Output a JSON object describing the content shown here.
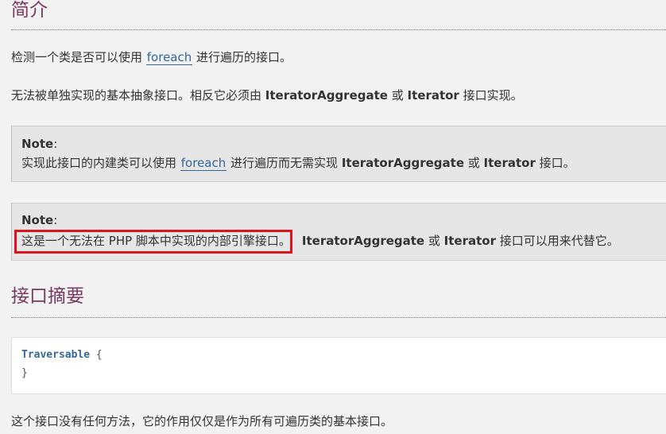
{
  "intro": {
    "title": "简介",
    "p1_before": "检测一个类是否可以使用 ",
    "p1_link": "foreach",
    "p1_after": " 进行遍历的接口。",
    "p2_before": "无法被单独实现的基本抽象接口。相反它必须由 ",
    "p2_strong1": "IteratorAggregate",
    "p2_mid": " 或 ",
    "p2_strong2": "Iterator",
    "p2_after": " 接口实现。"
  },
  "note1": {
    "label": "Note",
    "colon": ":",
    "before": "实现此接口的内建类可以使用 ",
    "link": "foreach",
    "mid": " 进行遍历而无需实现 ",
    "strong1": "IteratorAggregate",
    "or": " 或 ",
    "strong2": "Iterator",
    "after": " 接口。"
  },
  "note2": {
    "label": "Note",
    "colon": ":",
    "highlighted": "这是一个无法在 PHP 脚本中实现的内部引擎接口。",
    "strong1": "IteratorAggregate",
    "or": " 或 ",
    "strong2": "Iterator",
    "after": " 接口可以用来代替它。"
  },
  "synopsis": {
    "title": "接口摘要",
    "class_name": "Traversable",
    "open_brace": " {",
    "close_brace": "}",
    "footer": "这个接口没有任何方法，它的作用仅仅是作为所有可遍历类的基本接口。"
  },
  "colors": {
    "heading": "#793862",
    "link": "#336699",
    "highlight_border": "#e0131d",
    "note_bg": "#e6e6e6"
  }
}
